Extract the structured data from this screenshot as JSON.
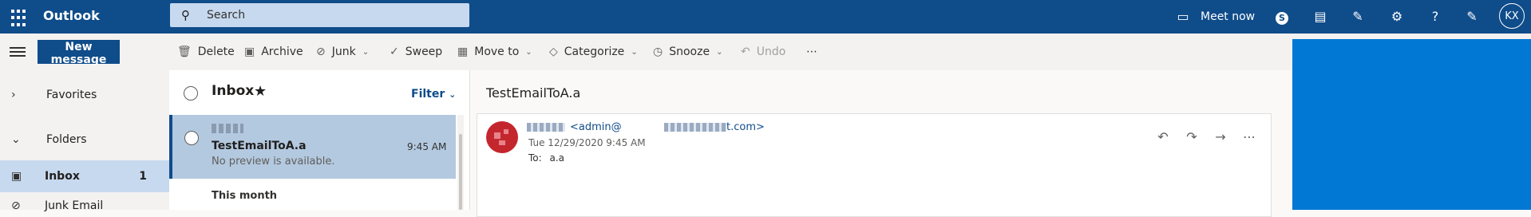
{
  "app": {
    "title": "Outlook"
  },
  "search": {
    "placeholder": "Search"
  },
  "topbar": {
    "meet_now": "Meet now",
    "avatar_initials": "KX"
  },
  "toolbar": {
    "new_message": "New message",
    "delete": "Delete",
    "archive": "Archive",
    "junk": "Junk",
    "sweep": "Sweep",
    "move_to": "Move to",
    "categorize": "Categorize",
    "snooze": "Snooze",
    "undo": "Undo",
    "more": "⋯"
  },
  "nav": {
    "favorites": "Favorites",
    "folders": "Folders",
    "inbox": {
      "label": "Inbox",
      "count": "1"
    },
    "junk_email": "Junk Email"
  },
  "list": {
    "title": "Inbox",
    "filter": "Filter",
    "messages": [
      {
        "subject": "TestEmailToA.a",
        "time": "9:45 AM",
        "preview": "No preview is available."
      }
    ],
    "group_header": "This month"
  },
  "reading": {
    "subject": "TestEmailToA.a",
    "from_address": "<admin@",
    "from_domain_end": "t.com>",
    "date": "Tue 12/29/2020 9:45 AM",
    "to_label": "To:",
    "to_value": "a.a"
  },
  "colors": {
    "brand": "#0f4c8a",
    "accent": "#0078d4",
    "selected": "#c7d9ee"
  }
}
